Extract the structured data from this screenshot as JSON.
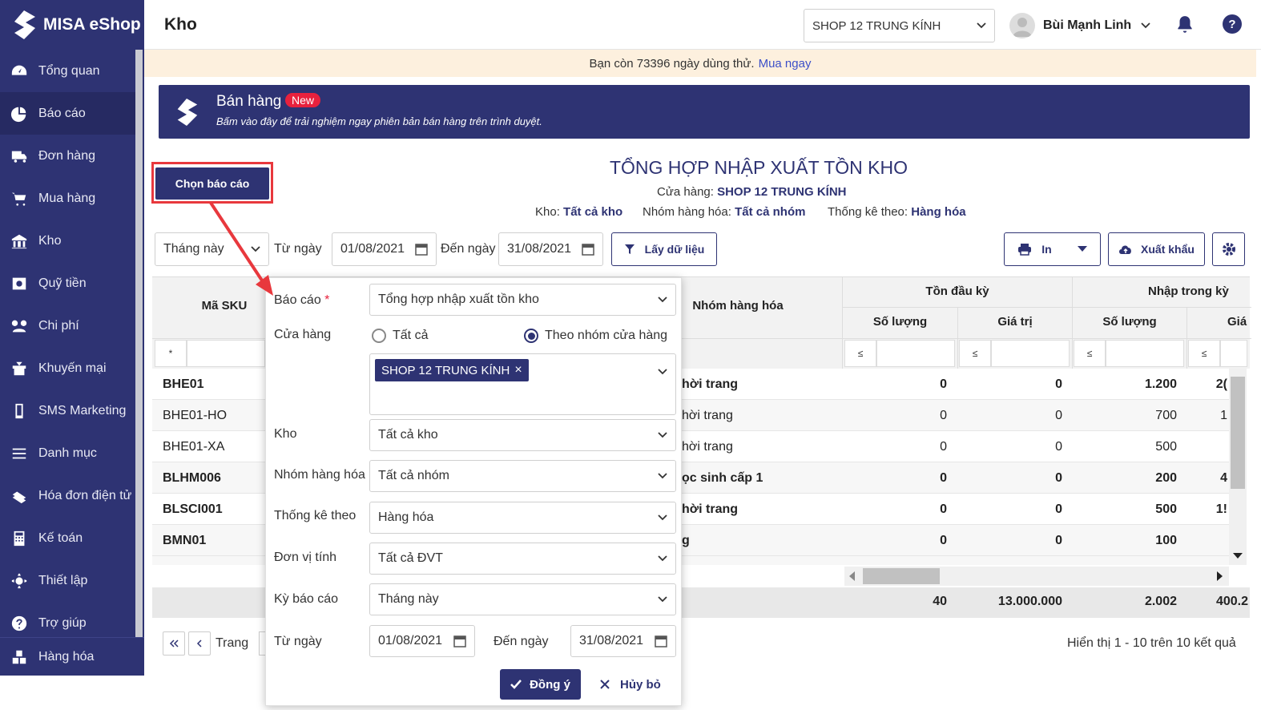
{
  "app": {
    "brand": "MISA eShop",
    "page_title": "Kho"
  },
  "header": {
    "shop": "SHOP 12 TRUNG KÍNH",
    "user": "Bùi Mạnh Linh",
    "help": "?"
  },
  "sidebar": {
    "items": [
      {
        "label": "Tổng quan",
        "icon": "dashboard-icon"
      },
      {
        "label": "Báo cáo",
        "icon": "pie-chart-icon"
      },
      {
        "label": "Đơn hàng",
        "icon": "truck-icon"
      },
      {
        "label": "Mua hàng",
        "icon": "cart-icon"
      },
      {
        "label": "Kho",
        "icon": "warehouse-icon"
      },
      {
        "label": "Quỹ tiền",
        "icon": "cash-icon"
      },
      {
        "label": "Chi phí",
        "icon": "expense-icon"
      },
      {
        "label": "Khuyến mại",
        "icon": "gift-icon"
      },
      {
        "label": "SMS Marketing",
        "icon": "phone-icon"
      },
      {
        "label": "Danh mục",
        "icon": "list-icon"
      },
      {
        "label": "Hóa đơn điện tử",
        "icon": "invoice-icon"
      },
      {
        "label": "Kế toán",
        "icon": "calculator-icon"
      },
      {
        "label": "Thiết lập",
        "icon": "gear-icon"
      },
      {
        "label": "Trợ giúp",
        "icon": "help-icon"
      }
    ],
    "bottom": "Hàng hóa"
  },
  "trial": {
    "text": "Bạn còn 73396 ngày dùng thử.",
    "link": "Mua ngay"
  },
  "banner": {
    "title": "Bán hàng",
    "badge": "New",
    "subtitle": "Bấm vào đây để trải nghiệm ngay phiên bản bán hàng trên trình duyệt."
  },
  "report": {
    "choose_button": "Chọn báo cáo",
    "title": "TỔNG HỢP NHẬP XUẤT TỒN KHO",
    "store_label": "Cửa hàng:",
    "store_value": "SHOP 12 TRUNG KÍNH",
    "warehouse_label": "Kho:",
    "warehouse_value": "Tất cả kho",
    "group_label": "Nhóm hàng hóa:",
    "group_value": "Tất cả nhóm",
    "stat_label": "Thống kê theo:",
    "stat_value": "Hàng hóa"
  },
  "filter": {
    "period": "Tháng này",
    "from_label": "Từ ngày",
    "from": "01/08/2021",
    "to_label": "Đến ngày",
    "to": "31/08/2021",
    "fetch": "Lấy dữ liệu",
    "print": "In",
    "export": "Xuất khẩu"
  },
  "table": {
    "col_sku": "Mã SKU",
    "col_group": "Nhóm hàng hóa",
    "grp_open": "Tồn đầu kỳ",
    "grp_in": "Nhập trong kỳ",
    "sub_qty": "Số lượng",
    "sub_val": "Giá trị",
    "sub_val_cut": "Giá",
    "filter_star": "*",
    "filter_le": "≤",
    "rows": [
      {
        "sku": "BHE01",
        "group": "hời trang",
        "q0": "0",
        "v0": "0",
        "qi": "1.200",
        "vi": "2(",
        "bold": true
      },
      {
        "sku": "BHE01-HO",
        "group": "hời trang",
        "q0": "0",
        "v0": "0",
        "qi": "700",
        "vi": "1",
        "bold": false
      },
      {
        "sku": "BHE01-XA",
        "group": "hời trang",
        "q0": "0",
        "v0": "0",
        "qi": "500",
        "vi": "",
        "bold": false
      },
      {
        "sku": "BLHM006",
        "group": "ọc sinh cấp 1",
        "q0": "0",
        "v0": "0",
        "qi": "200",
        "vi": "4",
        "bold": true
      },
      {
        "sku": "BLSCI001",
        "group": "hời trang",
        "q0": "0",
        "v0": "0",
        "qi": "500",
        "vi": "1!",
        "bold": true
      },
      {
        "sku": "BMN01",
        "group": "g",
        "q0": "0",
        "v0": "0",
        "qi": "100",
        "vi": "",
        "bold": true
      }
    ],
    "total": {
      "q0": "40",
      "v0": "13.000.000",
      "qi": "2.002",
      "vi": "400.2"
    },
    "pager_label": "Trang",
    "summary": "Hiển thị 1 - 10 trên 10 kết quả"
  },
  "popup": {
    "report_label": "Báo cáo",
    "report_value": "Tổng hợp nhập xuất tồn kho",
    "store_label": "Cửa hàng",
    "radio_all": "Tất cả",
    "radio_group": "Theo nhóm cửa hàng",
    "store_tag": "SHOP 12 TRUNG KÍNH",
    "warehouse_label": "Kho",
    "warehouse_value": "Tất cả kho",
    "group_label": "Nhóm hàng hóa",
    "group_value": "Tất cả nhóm",
    "stat_label": "Thống kê theo",
    "stat_value": "Hàng hóa",
    "unit_label": "Đơn vị tính",
    "unit_value": "Tất cả ĐVT",
    "period_label": "Kỳ báo cáo",
    "period_value": "Tháng này",
    "from_label": "Từ ngày",
    "from": "01/08/2021",
    "to_label": "Đến ngày",
    "to": "31/08/2021",
    "ok": "Đồng ý",
    "cancel": "Hủy bỏ"
  },
  "colors": {
    "brand": "#2e3373",
    "accent_red": "#e8383d",
    "trial_bg": "#fdf0de"
  }
}
